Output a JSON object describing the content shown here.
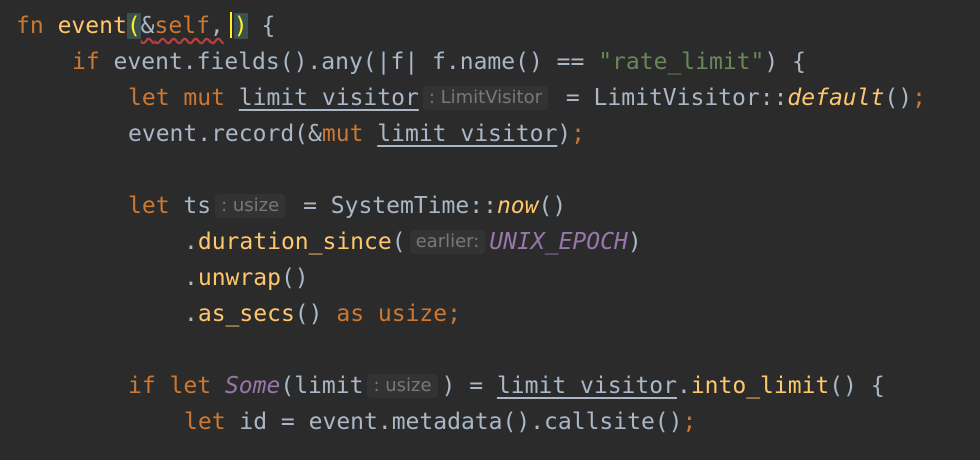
{
  "code": {
    "l1": {
      "fn": "fn",
      "name": "event",
      "open": "(",
      "amp": "&",
      "self": "self",
      "comma": ",",
      "close": ")",
      "brace": " {"
    },
    "l2": {
      "if": "if",
      "t1": " event.fields().any(|f| f.name() == ",
      "str": "\"rate_limit\"",
      "t2": ") {"
    },
    "l3": {
      "let": "let",
      "mut": " mut ",
      "var": "limit_visitor",
      "hint": ": LimitVisitor",
      "t1": "= LimitVisitor::",
      "method": "default",
      "t2": "()",
      "semi": ";"
    },
    "l4": {
      "t1": "event.record(&",
      "mut": "mut",
      "sp": " ",
      "var": "limit_visitor",
      "t2": ")",
      "semi": ";"
    },
    "l5": {
      "let": "let",
      "t1": " ts",
      "hint": ": usize",
      "t2": "= SystemTime::",
      "method": "now",
      "t3": "()"
    },
    "l6": {
      "t1": ".",
      "method": "duration_since",
      "t2": "(",
      "hint": "earlier:",
      "const": "UNIX_EPOCH",
      "t3": ")"
    },
    "l7": {
      "t1": ".",
      "method": "unwrap",
      "t2": "()"
    },
    "l8": {
      "t1": ".",
      "method": "as_secs",
      "t2": "() ",
      "as": "as",
      "usize": " usize",
      "semi": ";"
    },
    "l9": {
      "if": "if",
      "let": " let ",
      "some": "Some",
      "t1": "(limit",
      "hint": ": usize",
      "t2": ") = ",
      "var": "limit_visitor",
      "dot": ".",
      "method": "into_limit",
      "t3": "() {"
    },
    "l10": {
      "let": "let",
      "t1": " id = event.metadata().callsite()",
      "semi": ";"
    }
  },
  "colors": {
    "background": "#2b2b2b",
    "keyword": "#cc7832",
    "function": "#ffc66d",
    "string": "#6a8759",
    "constant": "#9876aa",
    "text": "#a9b7c6",
    "hint": "#787878",
    "error_squiggle": "#bc3f3c"
  }
}
